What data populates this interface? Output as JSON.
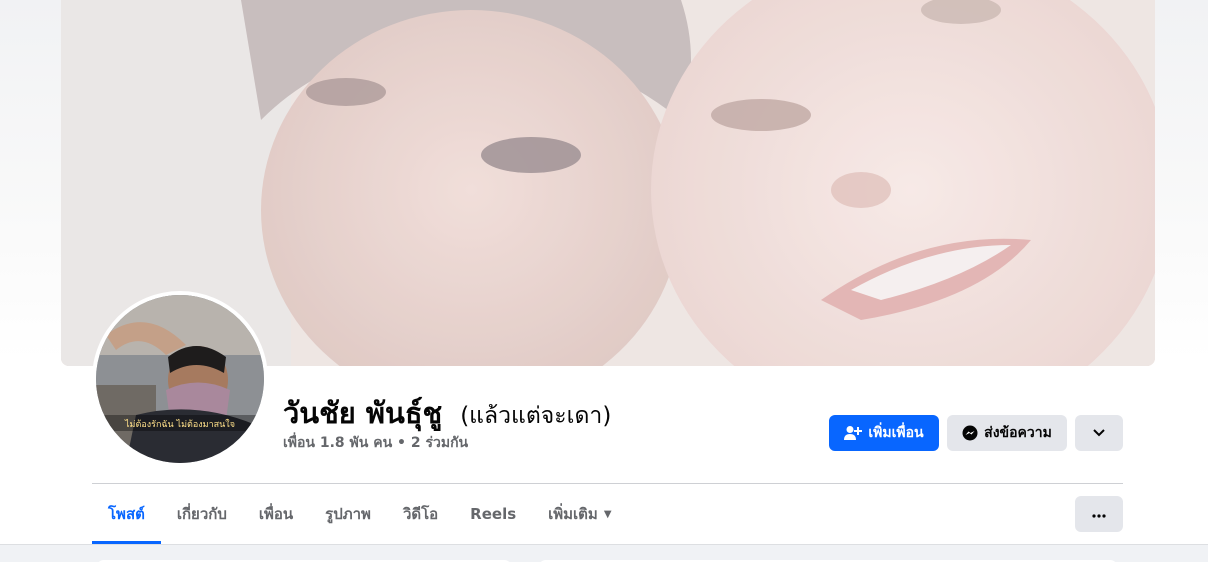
{
  "profile": {
    "name": "วันชัย พันธุ์ชู",
    "alternate_name": "(แล้วแต่จะเดา)",
    "friends_summary": "เพื่อน 1.8 พัน คน • 2 ร่วมกัน",
    "avatar_caption": "ไม่ต้องรักฉัน ไม่ต้องมาสนใจ"
  },
  "actions": {
    "add_friend": "เพิ่มเพื่อน",
    "add_friend_icon": "add-friend-icon",
    "message": "ส่งข้อความ",
    "message_icon": "messenger-icon",
    "more_icon": "chevron-down-icon"
  },
  "tabs": [
    {
      "label": "โพสต์",
      "active": true
    },
    {
      "label": "เกี่ยวกับ",
      "active": false
    },
    {
      "label": "เพื่อน",
      "active": false
    },
    {
      "label": "รูปภาพ",
      "active": false
    },
    {
      "label": "วิดีโอ",
      "active": false
    },
    {
      "label": "Reels",
      "active": false
    },
    {
      "label": "เพิ่มเติม",
      "active": false
    }
  ],
  "tab_more_icon": "ellipsis-icon",
  "colors": {
    "accent": "#0866ff",
    "secondary_button": "#e4e6eb",
    "text_primary": "#050505",
    "text_secondary": "#65676b"
  }
}
